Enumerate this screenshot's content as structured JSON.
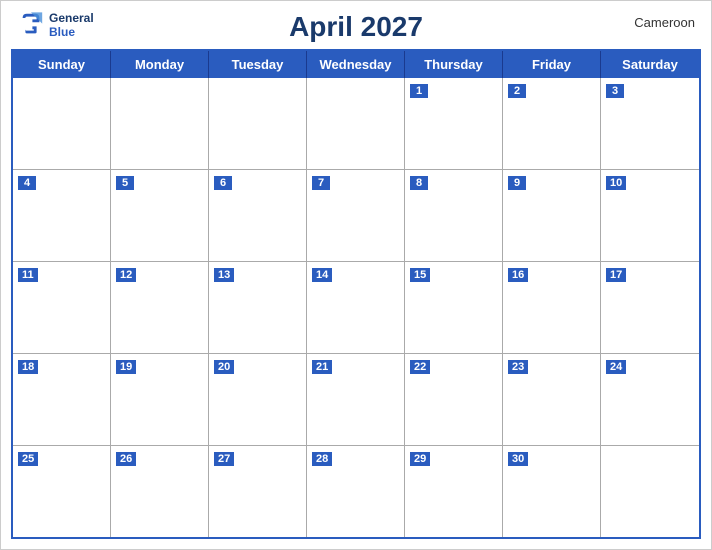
{
  "header": {
    "title": "April 2027",
    "country": "Cameroon",
    "logo_line1": "General",
    "logo_line2": "Blue"
  },
  "days_of_week": [
    "Sunday",
    "Monday",
    "Tuesday",
    "Wednesday",
    "Thursday",
    "Friday",
    "Saturday"
  ],
  "weeks": [
    [
      null,
      null,
      null,
      null,
      1,
      2,
      3
    ],
    [
      4,
      5,
      6,
      7,
      8,
      9,
      10
    ],
    [
      11,
      12,
      13,
      14,
      15,
      16,
      17
    ],
    [
      18,
      19,
      20,
      21,
      22,
      23,
      24
    ],
    [
      25,
      26,
      27,
      28,
      29,
      30,
      null
    ]
  ]
}
